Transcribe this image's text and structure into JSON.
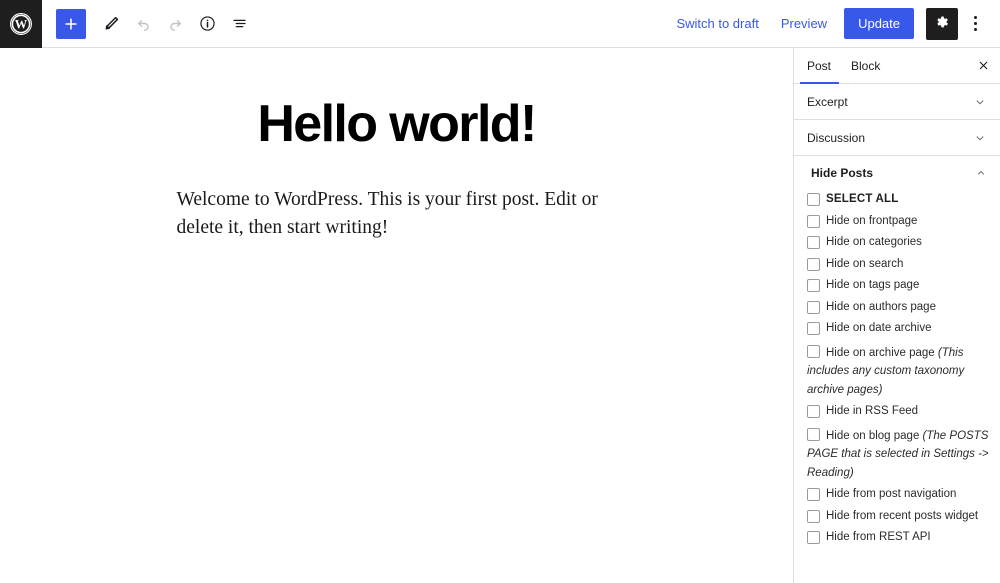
{
  "header": {
    "logo_icon": "wordpress-logo-icon",
    "tools": [
      {
        "icon": "plus-icon",
        "name": "add-block-button",
        "primary": true,
        "disabled": false
      },
      {
        "icon": "pencil-icon",
        "name": "edit-tool-button",
        "primary": false,
        "disabled": false
      },
      {
        "icon": "undo-icon",
        "name": "undo-button",
        "primary": false,
        "disabled": true
      },
      {
        "icon": "redo-icon",
        "name": "redo-button",
        "primary": false,
        "disabled": true
      },
      {
        "icon": "info-icon",
        "name": "details-button",
        "primary": false,
        "disabled": false
      },
      {
        "icon": "list-view-icon",
        "name": "list-view-button",
        "primary": false,
        "disabled": false
      }
    ],
    "switch_to_draft_label": "Switch to draft",
    "preview_label": "Preview",
    "update_label": "Update",
    "settings_icon": "gear-icon",
    "options_icon": "kebab-menu-icon",
    "accent_color": "#3858e9",
    "dark_color": "#1e1e1e"
  },
  "post": {
    "title": "Hello world!",
    "body": "Welcome to WordPress. This is your first post. Edit or delete it, then start writing!"
  },
  "sidebar": {
    "tabs": [
      {
        "label": "Post",
        "active": true
      },
      {
        "label": "Block",
        "active": false
      }
    ],
    "close_icon": "close-icon",
    "panels": [
      {
        "label": "Excerpt",
        "expanded": false,
        "chevron": "chevron-down-icon"
      },
      {
        "label": "Discussion",
        "expanded": false,
        "chevron": "chevron-down-icon"
      }
    ],
    "hide_posts": {
      "label": "Hide Posts",
      "expanded": true,
      "chevron": "chevron-up-icon",
      "items": [
        {
          "label": "SELECT ALL",
          "bold": true,
          "note": "",
          "checked": false
        },
        {
          "label": "Hide on frontpage",
          "bold": false,
          "note": "",
          "checked": false
        },
        {
          "label": "Hide on categories",
          "bold": false,
          "note": "",
          "checked": false
        },
        {
          "label": "Hide on search",
          "bold": false,
          "note": "",
          "checked": false
        },
        {
          "label": "Hide on tags page",
          "bold": false,
          "note": "",
          "checked": false
        },
        {
          "label": "Hide on authors page",
          "bold": false,
          "note": "",
          "checked": false
        },
        {
          "label": "Hide on date archive",
          "bold": false,
          "note": "",
          "checked": false
        },
        {
          "label": "Hide on archive page",
          "bold": false,
          "note": "(This includes any custom taxonomy archive pages)",
          "checked": false
        },
        {
          "label": "Hide in RSS Feed",
          "bold": false,
          "note": "",
          "checked": false
        },
        {
          "label": "Hide on blog page",
          "bold": false,
          "note": "(The POSTS PAGE that is selected in Settings -> Reading)",
          "checked": false
        },
        {
          "label": "Hide from post navigation",
          "bold": false,
          "note": "",
          "checked": false
        },
        {
          "label": "Hide from recent posts widget",
          "bold": false,
          "note": "",
          "checked": false
        },
        {
          "label": "Hide from REST API",
          "bold": false,
          "note": "",
          "checked": false
        }
      ]
    }
  }
}
